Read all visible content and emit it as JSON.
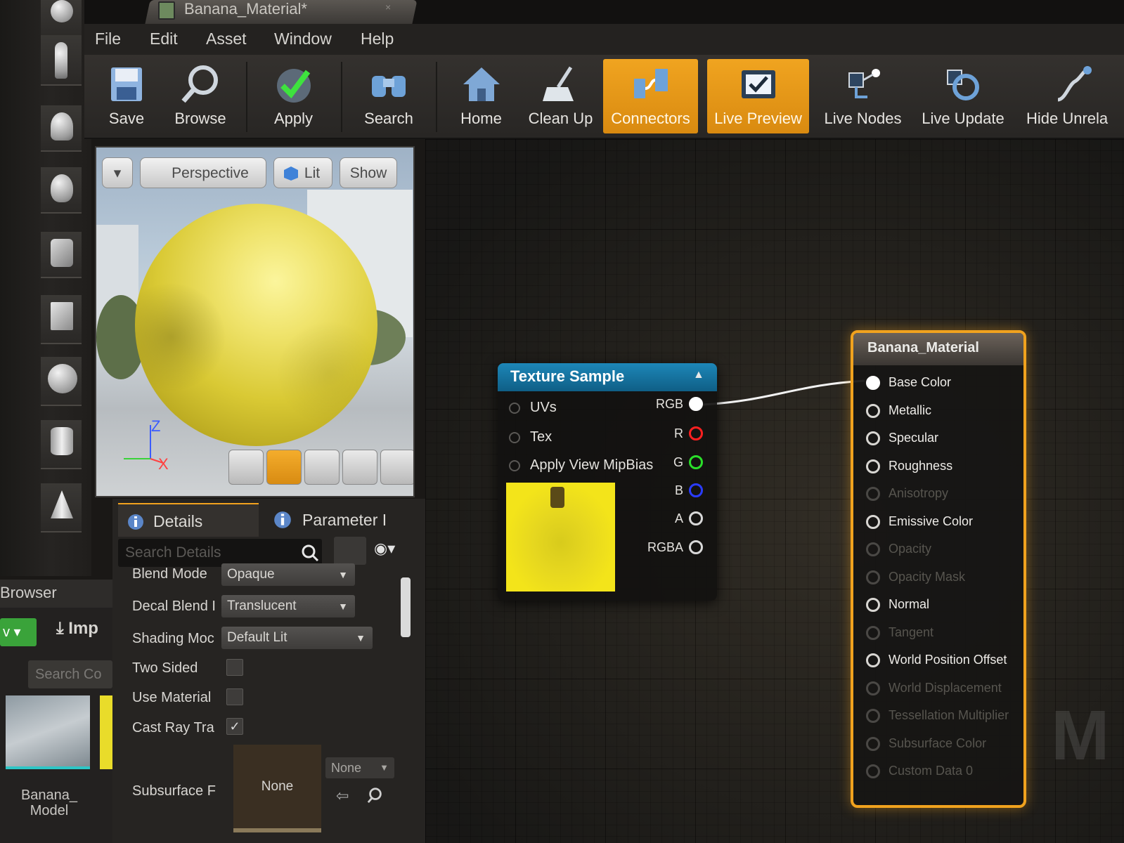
{
  "window": {
    "tab_title": "Banana_Material*",
    "tab_close": "×"
  },
  "menu": [
    "File",
    "Edit",
    "Asset",
    "Window",
    "Help"
  ],
  "toolbar": {
    "save": "Save",
    "browse": "Browse",
    "apply": "Apply",
    "search": "Search",
    "home": "Home",
    "clean_up": "Clean Up",
    "connectors": "Connectors",
    "live_preview": "Live Preview",
    "live_nodes": "Live Nodes",
    "live_update": "Live Update",
    "hide_unrelated": "Hide Unrela"
  },
  "viewport": {
    "dropdown": "▾",
    "perspective": "Perspective",
    "lit": "Lit",
    "show": "Show",
    "axis_z": "Z",
    "axis_x": "X"
  },
  "browser": {
    "title": "Browser",
    "add_button": "v ▾",
    "import": "Imp",
    "search_placeholder": "Search Co",
    "asset_name": "Banana_ Model"
  },
  "details": {
    "tab_details": "Details",
    "tab_parameters": "Parameter I",
    "search_placeholder": "Search Details",
    "props": {
      "blend_mode_label": "Blend Mode",
      "blend_mode_value": "Opaque",
      "decal_blend_label": "Decal Blend I",
      "decal_blend_value": "Translucent",
      "shading_label": "Shading Moc",
      "shading_value": "Default Lit",
      "two_sided_label": "Two Sided",
      "use_material_label": "Use Material",
      "cast_ray_label": "Cast Ray Tra",
      "subsurface_label": "Subsurface F",
      "subsurface_swatch": "None",
      "subsurface_select": "None"
    },
    "two_sided_checked": false,
    "use_material_checked": false,
    "cast_ray_checked": true
  },
  "texture_node": {
    "title": "Texture Sample",
    "inputs": [
      "UVs",
      "Tex",
      "Apply View MipBias"
    ],
    "outputs": [
      "RGB",
      "R",
      "G",
      "B",
      "A",
      "RGBA"
    ],
    "output_colors": [
      "#ffffff",
      "#ff2020",
      "#2adf2a",
      "#2a3cff",
      "#d8d8d8",
      "#d8d8d8"
    ],
    "collapse": "▲"
  },
  "material_node": {
    "title": "Banana_Material",
    "pins": [
      {
        "label": "Base Color",
        "connected": true,
        "enabled": true
      },
      {
        "label": "Metallic",
        "connected": false,
        "enabled": true
      },
      {
        "label": "Specular",
        "connected": false,
        "enabled": true
      },
      {
        "label": "Roughness",
        "connected": false,
        "enabled": true
      },
      {
        "label": "Anisotropy",
        "connected": false,
        "enabled": false
      },
      {
        "label": "Emissive Color",
        "connected": false,
        "enabled": true
      },
      {
        "label": "Opacity",
        "connected": false,
        "enabled": false
      },
      {
        "label": "Opacity Mask",
        "connected": false,
        "enabled": false
      },
      {
        "label": "Normal",
        "connected": false,
        "enabled": true
      },
      {
        "label": "Tangent",
        "connected": false,
        "enabled": false
      },
      {
        "label": "World Position Offset",
        "connected": false,
        "enabled": true
      },
      {
        "label": "World Displacement",
        "connected": false,
        "enabled": false
      },
      {
        "label": "Tessellation Multiplier",
        "connected": false,
        "enabled": false
      },
      {
        "label": "Subsurface Color",
        "connected": false,
        "enabled": false
      },
      {
        "label": "Custom Data 0",
        "connected": false,
        "enabled": false
      }
    ]
  },
  "graph": {
    "watermark": "M"
  },
  "colors": {
    "accent_orange": "#f0a21e",
    "texture_header": "#1d87b8"
  }
}
